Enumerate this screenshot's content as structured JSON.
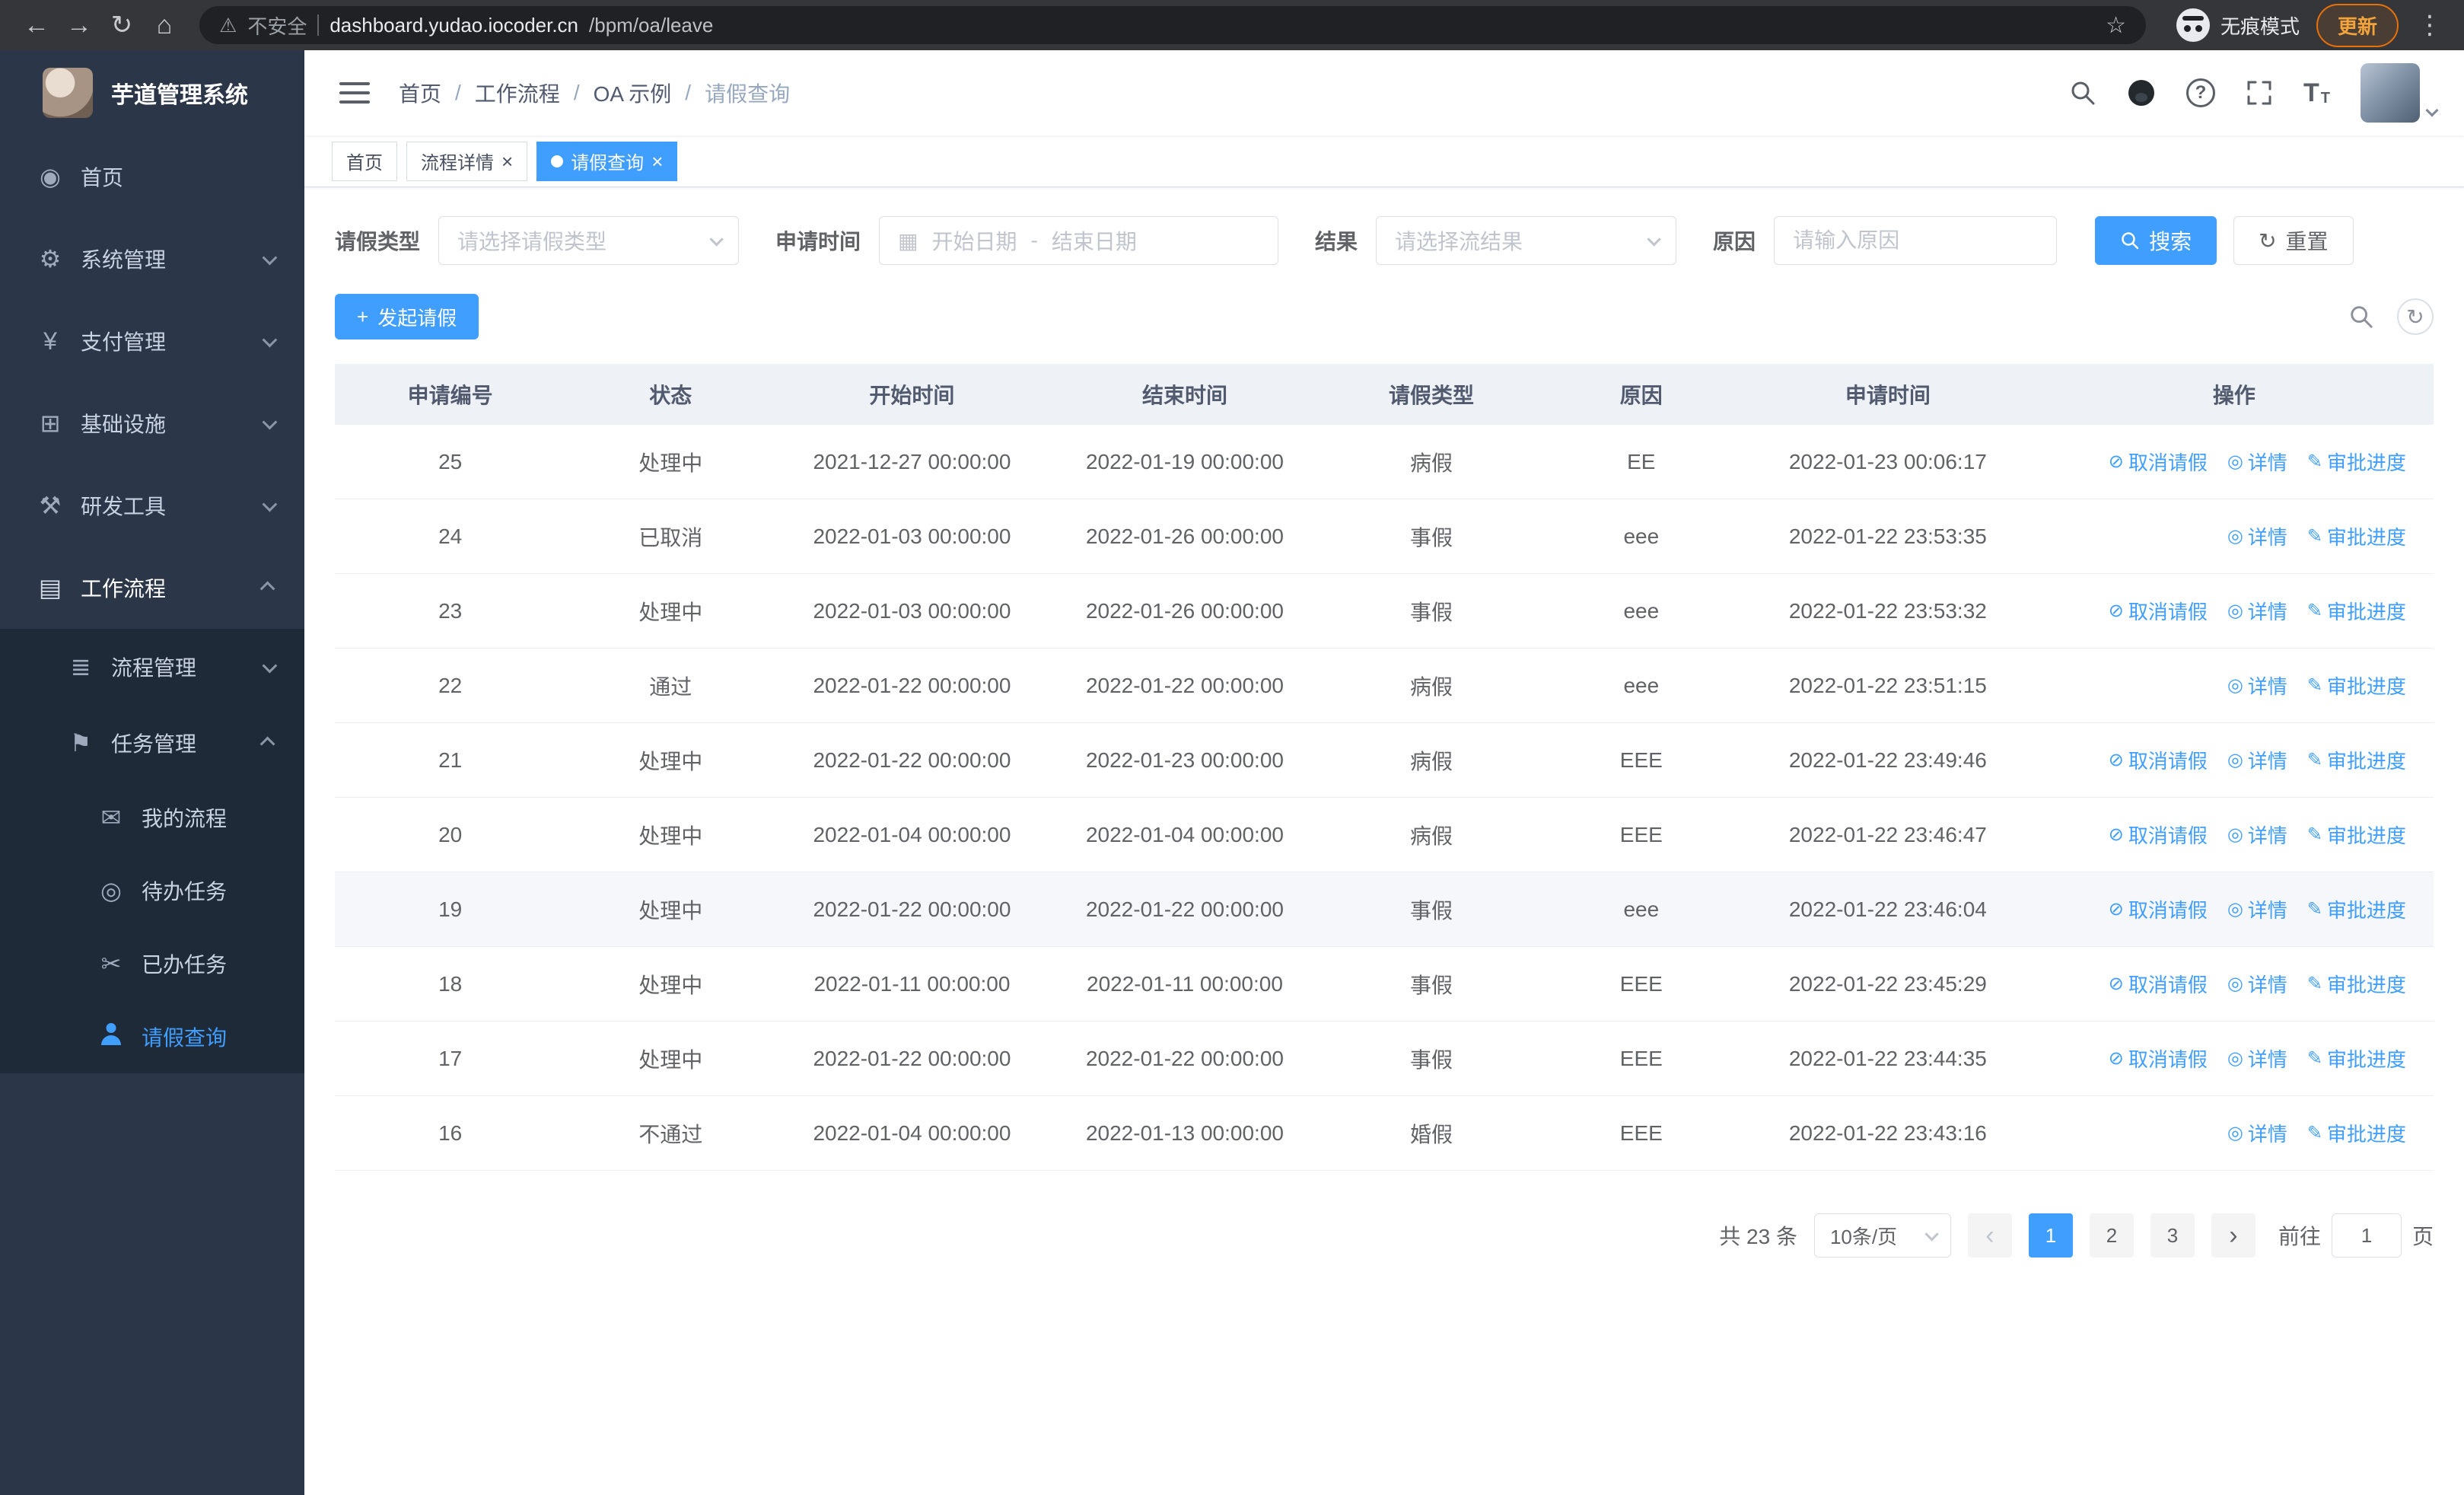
{
  "browser": {
    "security_label": "不安全",
    "url_host": "dashboard.yudao.iocoder.cn",
    "url_path": "/bpm/oa/leave",
    "incognito_label": "无痕模式",
    "update_label": "更新"
  },
  "sidebar": {
    "app_title": "芋道管理系统",
    "items": [
      {
        "key": "home",
        "label": "首页",
        "icon": "home-icon",
        "level": 1
      },
      {
        "key": "system",
        "label": "系统管理",
        "icon": "gear-icon",
        "level": 1,
        "chevron": "down"
      },
      {
        "key": "payment",
        "label": "支付管理",
        "icon": "yen-icon",
        "level": 1,
        "chevron": "down"
      },
      {
        "key": "infra",
        "label": "基础设施",
        "icon": "infra-icon",
        "level": 1,
        "chevron": "down"
      },
      {
        "key": "devtools",
        "label": "研发工具",
        "icon": "tools-icon",
        "level": 1,
        "chevron": "down"
      },
      {
        "key": "workflow",
        "label": "工作流程",
        "icon": "workflow-icon",
        "level": 1,
        "chevron": "up",
        "open": true
      },
      {
        "key": "process-mgmt",
        "label": "流程管理",
        "icon": "process-icon",
        "level": 2,
        "chevron": "down"
      },
      {
        "key": "task-mgmt",
        "label": "任务管理",
        "icon": "task-icon",
        "level": 2,
        "chevron": "up",
        "open": true
      },
      {
        "key": "my-process",
        "label": "我的流程",
        "icon": "chat-icon",
        "level": 3
      },
      {
        "key": "todo-task",
        "label": "待办任务",
        "icon": "eye-icon",
        "level": 3
      },
      {
        "key": "done-task",
        "label": "已办任务",
        "icon": "done-icon",
        "level": 3
      },
      {
        "key": "leave-query",
        "label": "请假查询",
        "icon": "person-icon",
        "level": 3,
        "active": true
      }
    ]
  },
  "header": {
    "breadcrumb": [
      "首页",
      "工作流程",
      "OA 示例",
      "请假查询"
    ]
  },
  "tabs": [
    {
      "key": "home",
      "label": "首页",
      "closable": false,
      "active": false
    },
    {
      "key": "process-detail",
      "label": "流程详情",
      "closable": true,
      "active": false
    },
    {
      "key": "leave-query",
      "label": "请假查询",
      "closable": true,
      "active": true
    }
  ],
  "filters": {
    "leave_type_label": "请假类型",
    "leave_type_placeholder": "请选择请假类型",
    "apply_time_label": "申请时间",
    "start_placeholder": "开始日期",
    "range_separator": "-",
    "end_placeholder": "结束日期",
    "result_label": "结果",
    "result_placeholder": "请选择流结果",
    "reason_label": "原因",
    "reason_placeholder": "请输入原因",
    "search_label": "搜索",
    "reset_label": "重置"
  },
  "toolbar": {
    "create_label": "发起请假"
  },
  "table": {
    "columns": [
      "申请编号",
      "状态",
      "开始时间",
      "结束时间",
      "请假类型",
      "原因",
      "申请时间",
      "操作"
    ],
    "rows": [
      {
        "id": "25",
        "status": "处理中",
        "start": "2021-12-27 00:00:00",
        "end": "2022-01-19 00:00:00",
        "type": "病假",
        "reason": "EE",
        "applied": "2022-01-23 00:06:17",
        "actions": [
          {
            "label": "取消请假",
            "icon": "cancel-icon"
          },
          {
            "label": "详情",
            "icon": "view-icon"
          },
          {
            "label": "审批进度",
            "icon": "progress-icon"
          }
        ]
      },
      {
        "id": "24",
        "status": "已取消",
        "start": "2022-01-03 00:00:00",
        "end": "2022-01-26 00:00:00",
        "type": "事假",
        "reason": "eee",
        "applied": "2022-01-22 23:53:35",
        "actions": [
          {
            "label": "详情",
            "icon": "view-icon"
          },
          {
            "label": "审批进度",
            "icon": "progress-icon"
          }
        ]
      },
      {
        "id": "23",
        "status": "处理中",
        "start": "2022-01-03 00:00:00",
        "end": "2022-01-26 00:00:00",
        "type": "事假",
        "reason": "eee",
        "applied": "2022-01-22 23:53:32",
        "actions": [
          {
            "label": "取消请假",
            "icon": "cancel-icon"
          },
          {
            "label": "详情",
            "icon": "view-icon"
          },
          {
            "label": "审批进度",
            "icon": "progress-icon"
          }
        ]
      },
      {
        "id": "22",
        "status": "通过",
        "start": "2022-01-22 00:00:00",
        "end": "2022-01-22 00:00:00",
        "type": "病假",
        "reason": "eee",
        "applied": "2022-01-22 23:51:15",
        "actions": [
          {
            "label": "详情",
            "icon": "view-icon"
          },
          {
            "label": "审批进度",
            "icon": "progress-icon"
          }
        ]
      },
      {
        "id": "21",
        "status": "处理中",
        "start": "2022-01-22 00:00:00",
        "end": "2022-01-23 00:00:00",
        "type": "病假",
        "reason": "EEE",
        "applied": "2022-01-22 23:49:46",
        "actions": [
          {
            "label": "取消请假",
            "icon": "cancel-icon"
          },
          {
            "label": "详情",
            "icon": "view-icon"
          },
          {
            "label": "审批进度",
            "icon": "progress-icon"
          }
        ]
      },
      {
        "id": "20",
        "status": "处理中",
        "start": "2022-01-04 00:00:00",
        "end": "2022-01-04 00:00:00",
        "type": "病假",
        "reason": "EEE",
        "applied": "2022-01-22 23:46:47",
        "actions": [
          {
            "label": "取消请假",
            "icon": "cancel-icon"
          },
          {
            "label": "详情",
            "icon": "view-icon"
          },
          {
            "label": "审批进度",
            "icon": "progress-icon"
          }
        ]
      },
      {
        "id": "19",
        "status": "处理中",
        "start": "2022-01-22 00:00:00",
        "end": "2022-01-22 00:00:00",
        "type": "事假",
        "reason": "eee",
        "applied": "2022-01-22 23:46:04",
        "highlighted": true,
        "actions": [
          {
            "label": "取消请假",
            "icon": "cancel-icon"
          },
          {
            "label": "详情",
            "icon": "view-icon"
          },
          {
            "label": "审批进度",
            "icon": "progress-icon"
          }
        ]
      },
      {
        "id": "18",
        "status": "处理中",
        "start": "2022-01-11 00:00:00",
        "end": "2022-01-11 00:00:00",
        "type": "事假",
        "reason": "EEE",
        "applied": "2022-01-22 23:45:29",
        "actions": [
          {
            "label": "取消请假",
            "icon": "cancel-icon"
          },
          {
            "label": "详情",
            "icon": "view-icon"
          },
          {
            "label": "审批进度",
            "icon": "progress-icon"
          }
        ]
      },
      {
        "id": "17",
        "status": "处理中",
        "start": "2022-01-22 00:00:00",
        "end": "2022-01-22 00:00:00",
        "type": "事假",
        "reason": "EEE",
        "applied": "2022-01-22 23:44:35",
        "actions": [
          {
            "label": "取消请假",
            "icon": "cancel-icon"
          },
          {
            "label": "详情",
            "icon": "view-icon"
          },
          {
            "label": "审批进度",
            "icon": "progress-icon"
          }
        ]
      },
      {
        "id": "16",
        "status": "不通过",
        "start": "2022-01-04 00:00:00",
        "end": "2022-01-13 00:00:00",
        "type": "婚假",
        "reason": "EEE",
        "applied": "2022-01-22 23:43:16",
        "actions": [
          {
            "label": "详情",
            "icon": "view-icon"
          },
          {
            "label": "审批进度",
            "icon": "progress-icon"
          }
        ]
      }
    ]
  },
  "pagination": {
    "total_label": "共 23 条",
    "page_size": "10条/页",
    "pages": [
      "1",
      "2",
      "3"
    ],
    "active_page": "1",
    "prev_glyph": "‹",
    "next_glyph": "›",
    "goto_label": "前往",
    "goto_value": "1",
    "unit_label": "页"
  },
  "icons": {
    "home-icon": "◉",
    "gear-icon": "⚙",
    "yen-icon": "¥",
    "infra-icon": "⊞",
    "tools-icon": "⚒",
    "workflow-icon": "▤",
    "process-icon": "≣",
    "task-icon": "⚑",
    "chat-icon": "✉",
    "eye-icon": "◎",
    "done-icon": "✂",
    "cancel-icon": "⊘",
    "view-icon": "◎",
    "progress-icon": "✎",
    "back-icon": "←",
    "forward-icon": "→",
    "reload-icon": "↻",
    "home-nav-icon": "⌂",
    "warning-icon": "⚠",
    "bookmark-icon": "☆",
    "menu-icon": "⋮",
    "help-icon": "?",
    "plus-icon": "+",
    "refresh-icon": "↻",
    "calendar-icon": "▦",
    "close-icon": "×"
  }
}
